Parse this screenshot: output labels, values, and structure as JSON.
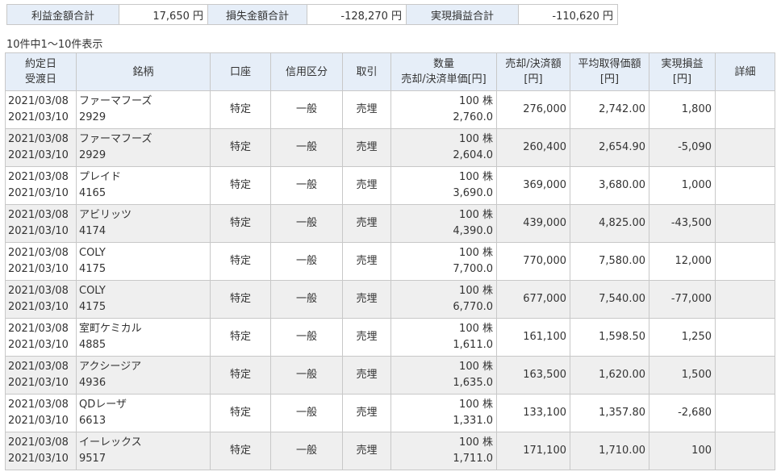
{
  "summary": {
    "profit_label": "利益金額合計",
    "profit_value": "17,650 円",
    "loss_label": "損失金額合計",
    "loss_value": "-128,270 円",
    "realized_label": "実現損益合計",
    "realized_value": "-110,620 円"
  },
  "count_text": "10件中1～10件表示",
  "headers": {
    "contract_date": "約定日",
    "delivery_date": "受渡日",
    "name": "銘柄",
    "account": "口座",
    "credit": "信用区分",
    "trade": "取引",
    "qty": "数量",
    "unit_price": "売却/決済単価[円]",
    "amount_1": "売却/決済額",
    "amount_2": "[円]",
    "avg_1": "平均取得価額",
    "avg_2": "[円]",
    "pl_1": "実現損益",
    "pl_2": "[円]",
    "detail": "詳細"
  },
  "rows": [
    {
      "contract_date": "2021/03/08",
      "delivery_date": "2021/03/10",
      "name": "ファーマフーズ",
      "code": "2929",
      "account": "特定",
      "credit": "一般",
      "trade": "売埋",
      "qty": "100 株",
      "unit_price": "2,760.0",
      "amount": "276,000",
      "avg_price": "2,742.00",
      "pl": "1,800"
    },
    {
      "contract_date": "2021/03/08",
      "delivery_date": "2021/03/10",
      "name": "ファーマフーズ",
      "code": "2929",
      "account": "特定",
      "credit": "一般",
      "trade": "売埋",
      "qty": "100 株",
      "unit_price": "2,604.0",
      "amount": "260,400",
      "avg_price": "2,654.90",
      "pl": "-5,090"
    },
    {
      "contract_date": "2021/03/08",
      "delivery_date": "2021/03/10",
      "name": "プレイド",
      "code": "4165",
      "account": "特定",
      "credit": "一般",
      "trade": "売埋",
      "qty": "100 株",
      "unit_price": "3,690.0",
      "amount": "369,000",
      "avg_price": "3,680.00",
      "pl": "1,000"
    },
    {
      "contract_date": "2021/03/08",
      "delivery_date": "2021/03/10",
      "name": "アビリッツ",
      "code": "4174",
      "account": "特定",
      "credit": "一般",
      "trade": "売埋",
      "qty": "100 株",
      "unit_price": "4,390.0",
      "amount": "439,000",
      "avg_price": "4,825.00",
      "pl": "-43,500"
    },
    {
      "contract_date": "2021/03/08",
      "delivery_date": "2021/03/10",
      "name": "COLY",
      "code": "4175",
      "account": "特定",
      "credit": "一般",
      "trade": "売埋",
      "qty": "100 株",
      "unit_price": "7,700.0",
      "amount": "770,000",
      "avg_price": "7,580.00",
      "pl": "12,000"
    },
    {
      "contract_date": "2021/03/08",
      "delivery_date": "2021/03/10",
      "name": "COLY",
      "code": "4175",
      "account": "特定",
      "credit": "一般",
      "trade": "売埋",
      "qty": "100 株",
      "unit_price": "6,770.0",
      "amount": "677,000",
      "avg_price": "7,540.00",
      "pl": "-77,000"
    },
    {
      "contract_date": "2021/03/08",
      "delivery_date": "2021/03/10",
      "name": "室町ケミカル",
      "code": "4885",
      "account": "特定",
      "credit": "一般",
      "trade": "売埋",
      "qty": "100 株",
      "unit_price": "1,611.0",
      "amount": "161,100",
      "avg_price": "1,598.50",
      "pl": "1,250"
    },
    {
      "contract_date": "2021/03/08",
      "delivery_date": "2021/03/10",
      "name": "アクシージア",
      "code": "4936",
      "account": "特定",
      "credit": "一般",
      "trade": "売埋",
      "qty": "100 株",
      "unit_price": "1,635.0",
      "amount": "163,500",
      "avg_price": "1,620.00",
      "pl": "1,500"
    },
    {
      "contract_date": "2021/03/08",
      "delivery_date": "2021/03/10",
      "name": "QDレーザ",
      "code": "6613",
      "account": "特定",
      "credit": "一般",
      "trade": "売埋",
      "qty": "100 株",
      "unit_price": "1,331.0",
      "amount": "133,100",
      "avg_price": "1,357.80",
      "pl": "-2,680"
    },
    {
      "contract_date": "2021/03/08",
      "delivery_date": "2021/03/10",
      "name": "イーレックス",
      "code": "9517",
      "account": "特定",
      "credit": "一般",
      "trade": "売埋",
      "qty": "100 株",
      "unit_price": "1,711.0",
      "amount": "171,100",
      "avg_price": "1,710.00",
      "pl": "100"
    }
  ],
  "colors": {
    "header_bg": "#e6eef8",
    "alt_row_bg": "#efefef",
    "border": "#c8c8c8"
  }
}
